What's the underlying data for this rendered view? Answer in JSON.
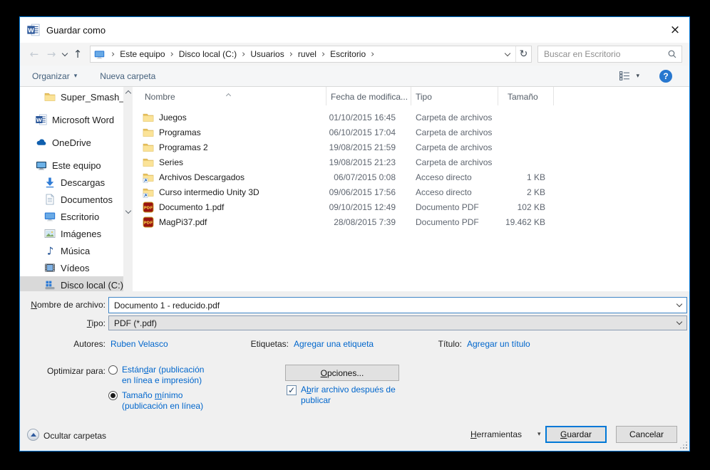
{
  "window": {
    "title": "Guardar como",
    "close_glyph": "×"
  },
  "icons": {
    "back": "←",
    "forward": "→",
    "up": "↑",
    "refresh": "↻",
    "crumb_sep": "›",
    "dropdown": "▾",
    "check": "✓",
    "help": "?"
  },
  "navbar": {
    "breadcrumb": [
      "Este equipo",
      "Disco local (C:)",
      "Usuarios",
      "ruvel",
      "Escritorio"
    ],
    "search_placeholder": "Buscar en Escritorio"
  },
  "toolbar": {
    "organize": "Organizar",
    "new_folder": "Nueva carpeta"
  },
  "sidebar": {
    "items": [
      {
        "label": "Super_Smash_Br",
        "icon": "folder"
      },
      {
        "label": "Microsoft Word",
        "icon": "word"
      },
      {
        "label": "OneDrive",
        "icon": "onedrive-cloud"
      },
      {
        "label": "Este equipo",
        "icon": "computer"
      },
      {
        "label": "Descargas",
        "icon": "downloads-arrow"
      },
      {
        "label": "Documentos",
        "icon": "document"
      },
      {
        "label": "Escritorio",
        "icon": "desktop"
      },
      {
        "label": "Imágenes",
        "icon": "picture"
      },
      {
        "label": "Música",
        "icon": "music-note"
      },
      {
        "label": "Vídeos",
        "icon": "filmstrip"
      },
      {
        "label": "Disco local (C:)",
        "icon": "drive",
        "selected": true
      }
    ]
  },
  "filelist": {
    "columns": [
      "Nombre",
      "Fecha de modifica...",
      "Tipo",
      "Tamaño"
    ],
    "rows": [
      {
        "name": "Juegos",
        "icon": "folder",
        "date": "01/10/2015 16:45",
        "type": "Carpeta de archivos",
        "size": ""
      },
      {
        "name": "Programas",
        "icon": "folder",
        "date": "06/10/2015 17:04",
        "type": "Carpeta de archivos",
        "size": ""
      },
      {
        "name": "Programas 2",
        "icon": "folder",
        "date": "19/08/2015 21:59",
        "type": "Carpeta de archivos",
        "size": ""
      },
      {
        "name": "Series",
        "icon": "folder",
        "date": "19/08/2015 21:23",
        "type": "Carpeta de archivos",
        "size": ""
      },
      {
        "name": "Archivos Descargados",
        "icon": "folder-shortcut",
        "date": "06/07/2015 0:08",
        "type": "Acceso directo",
        "size": "1 KB"
      },
      {
        "name": "Curso intermedio Unity 3D",
        "icon": "folder-shortcut",
        "date": "09/06/2015 17:56",
        "type": "Acceso directo",
        "size": "2 KB"
      },
      {
        "name": "Documento 1.pdf",
        "icon": "pdf",
        "date": "09/10/2015 12:49",
        "type": "Documento PDF",
        "size": "102 KB"
      },
      {
        "name": "MagPi37.pdf",
        "icon": "pdf",
        "date": "28/08/2015 7:39",
        "type": "Documento PDF",
        "size": "19.462 KB"
      }
    ]
  },
  "fields": {
    "filename_label": "Nombre de archivo:",
    "filename_value": "Documento 1 - reducido.pdf",
    "type_label": "Tipo:",
    "type_value": "PDF (*.pdf)",
    "authors_label": "Autores:",
    "authors_value": "Ruben Velasco",
    "tags_label": "Etiquetas:",
    "tags_value": "Agregar una etiqueta",
    "title_label": "Título:",
    "title_value": "Agregar un título",
    "optimize_label": "Optimizar para:",
    "optimize_standard": "Estándar (publicación en línea e impresión)",
    "optimize_minimum": "Tamaño mínimo (publicación en línea)",
    "options_button": "Opciones...",
    "open_after": "Abrir archivo después de publicar"
  },
  "footer": {
    "hide_folders": "Ocultar carpetas",
    "tools": "Herramientas",
    "save": "Guardar",
    "cancel": "Cancelar"
  },
  "colors": {
    "accent": "#0078d7",
    "link": "#0066cc",
    "selection_gray": "#d9d9d9"
  }
}
